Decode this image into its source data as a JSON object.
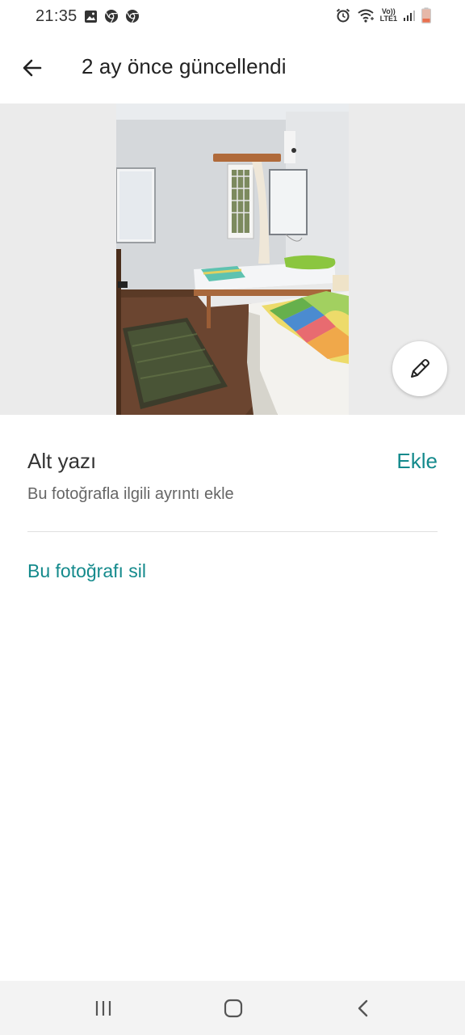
{
  "status_bar": {
    "time": "21:35",
    "left_icons": [
      "gallery-icon",
      "chrome-icon",
      "chrome-icon"
    ],
    "right_icons": [
      "alarm-icon",
      "wifi-icon",
      "volte-icon",
      "signal-icon",
      "battery-icon"
    ],
    "volte_top": "Vo))",
    "volte_bottom": "LTE1"
  },
  "app_bar": {
    "back_icon": "arrow-left-icon",
    "title": "2 ay önce güncellendi"
  },
  "photo": {
    "description_icon": "room-photo",
    "edit_icon": "pencil-icon"
  },
  "caption": {
    "label": "Alt yazı",
    "add_label": "Ekle",
    "hint": "Bu fotoğrafla ilgili ayrıntı ekle"
  },
  "actions": {
    "delete_label": "Bu fotoğrafı sil"
  },
  "colors": {
    "accent": "#148a8c",
    "photo_background": "#ebebeb",
    "nav_background": "#f3f3f3"
  },
  "nav_bar": {
    "icons": [
      "recent-apps-icon",
      "home-icon",
      "back-icon"
    ]
  }
}
